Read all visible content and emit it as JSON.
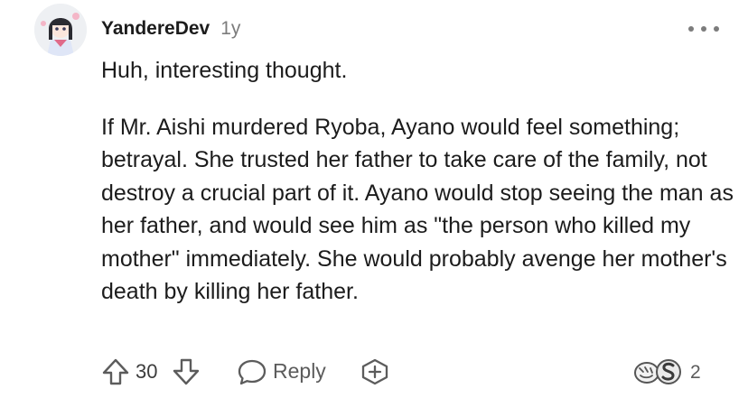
{
  "comment": {
    "author": "YandereDev",
    "age": "1y",
    "paragraphs": [
      "Huh, interesting thought.",
      "If Mr. Aishi murdered Ryoba, Ayano would feel something; betrayal. She trusted her father to take care of the family, not destroy a crucial part of it. Ayano would stop seeing the man as her father, and would see him as \"the person who killed my mother\" immediately. She would probably avenge her mother's death by killing her father."
    ]
  },
  "actions": {
    "score": "30",
    "reply_label": "Reply",
    "award_count": "2"
  },
  "icons": {
    "more": "more-options-icon",
    "upvote": "upvote-arrow-icon",
    "downvote": "downvote-arrow-icon",
    "reply": "speech-bubble-icon",
    "award": "add-award-icon"
  },
  "colors": {
    "text": "#1c1c1c",
    "meta": "#7c7c7c",
    "icon": "#5c5c5c"
  }
}
